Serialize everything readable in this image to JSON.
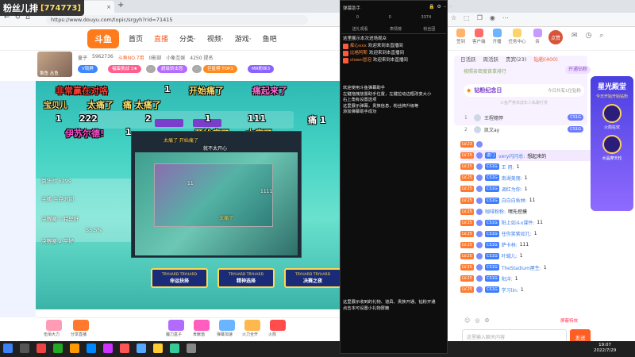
{
  "overlay_badge": {
    "title": "粉丝儿排",
    "count": "[774773]"
  },
  "browser": {
    "tab_title": "【粉丝儿排】小",
    "url": "https://www.douyu.com/topic/srgyh?rid=71415"
  },
  "site": {
    "logo": "斗鱼",
    "nav": [
      "首页",
      "直播",
      "分类·",
      "视频·",
      "游戏·",
      "鱼吧"
    ],
    "header_icons": [
      "签到",
      "客户端",
      "开播",
      "任务中心",
      "亲"
    ],
    "avatar_text": "点赞"
  },
  "room": {
    "meta": [
      "童子",
      "5962736",
      "斗鱼NO.7用",
      "0影部",
      "小象互娱",
      "4250 提名"
    ],
    "name_tag": "鲁鱼 丛鱼",
    "v_label": "V锁屏",
    "pills": [
      "福蛋挑战 3★",
      "·",
      "超级斩击怒",
      "·",
      "巨星榜 TOP3",
      "MR粉丝3"
    ]
  },
  "video": {
    "danmaku": [
      {
        "text": "非常赢在对咯",
        "color": "#ff3b30"
      },
      {
        "text": "1",
        "color": "#ffffff"
      },
      {
        "text": "开始痛了",
        "color": "#ffe066"
      },
      {
        "text": "痛起来了",
        "color": "#ff6ad5"
      },
      {
        "text": "宝贝儿",
        "color": "#ffe066"
      },
      {
        "text": "太痛了",
        "color": "#ffe066"
      },
      {
        "text": "痛 太痛了",
        "color": "#ffe066"
      },
      {
        "text": "1",
        "color": "#ffffff"
      },
      {
        "text": "222",
        "color": "#ffffff"
      },
      {
        "text": "2",
        "color": "#ffffff"
      },
      {
        "text": "1",
        "color": "#ffffff"
      },
      {
        "text": "111",
        "color": "#ffffff"
      },
      {
        "text": "痛 1",
        "color": "#ffffff"
      },
      {
        "text": "伊苏尔德!",
        "color": "#ff4dd2"
      },
      {
        "text": "1",
        "color": "#ffffff"
      },
      {
        "text": "开始痛了",
        "color": "#ffe066"
      },
      {
        "text": "太痛了",
        "color": "#ffe066"
      }
    ],
    "left_texts": [
      "倒计时 529s",
      "主播 生存时间",
      "决赛圈 1 特异好",
      "55.5%",
      "决赛圈 2 平好"
    ],
    "inner_danmaku": [
      "太痛了 开始痛了",
      "就不太开心",
      "11",
      "1111",
      "太痛了"
    ],
    "game_buttons": [
      {
        "top": "TRYHARD TRYHARD",
        "label": "命运抉择"
      },
      {
        "top": "TRYHARD TRYHARD",
        "label": "精神选择"
      },
      {
        "top": "TRYHARD TRYHARD",
        "label": "决赛之夜"
      }
    ]
  },
  "gifts": [
    "伍佰大力",
    "分享直播",
    "魔力盒子",
    "贡献值",
    "弹幕加速",
    "火力全开",
    "火箭"
  ],
  "helper": {
    "title": "弹幕助手",
    "stats": [
      "0",
      "0",
      "3374"
    ],
    "tabs": [
      "送礼观看",
      "表情榜",
      "粉丝团"
    ],
    "lines": [
      {
        "name": "",
        "text": "这里展示本次进场观众"
      },
      {
        "name": "痴心xxx",
        "text": "欢迎来到本直播间"
      },
      {
        "name": "比格阿斯",
        "text": "欢迎来到本直播间"
      },
      {
        "name": "clown冒泡",
        "text": "欢迎来到本直播间"
      }
    ],
    "help_text": [
      "欢迎使用斗鱼弹幕助手",
      "左键拖拽放置助手位置，左键拉动边框改变大小",
      "右上角有设置选项",
      "这里展示弹幕，贵族信息，粉丝牌升级等",
      "添加弹幕助手成功"
    ],
    "bottom_text": [
      "这里展示收到的礼物、道具、贵族开通、钻粉开通",
      "点击本可设置小礼物屏蔽"
    ]
  },
  "rank": {
    "tabs": [
      "日活跃",
      "周活跃",
      "贵宾(23)",
      "钻粉(400)"
    ],
    "hint": "按照亲密度背拿排行",
    "join": "开通钻粉",
    "badge_label": "钻粉纪念日",
    "badge_right": "今日共有1位钻粉",
    "sub_hint": "斗鱼严禁未成年人私聊打赏",
    "rows": [
      {
        "no": "1",
        "name": "王程穗悍",
        "lv": "CS1G"
      },
      {
        "no": "2",
        "name": "凯文ay",
        "lv": "CS1G"
      }
    ]
  },
  "promo": {
    "title": "星光殿堂",
    "sub": "今日开始开始钻粉",
    "labels": [
      "火箭狂欢",
      "水晶摩天轮"
    ]
  },
  "chat": [
    {
      "lv": "LV.23",
      "cs": "",
      "name": "",
      "text": "",
      "hl": false
    },
    {
      "lv": "LV.25",
      "cs": "进门",
      "name": "very闪闪总:",
      "text": "想起来的",
      "hl": true
    },
    {
      "lv": "LV.25",
      "cs": "CS1G",
      "name": "王 用:",
      "text": "1",
      "hl": false
    },
    {
      "lv": "LV.25",
      "cs": "CS1G",
      "name": "南湖美丽:",
      "text": "1",
      "hl": false
    },
    {
      "lv": "LV.25",
      "cs": "CS1G",
      "name": "调红为你:",
      "text": "1",
      "hl": false
    },
    {
      "lv": "LV.25",
      "cs": "CS1G",
      "name": "白白白秋林:",
      "text": "11",
      "hl": false
    },
    {
      "lv": "LV.25",
      "cs": "",
      "name": "咖啡粉粉:",
      "text": "嘿先挖摸",
      "hl": false
    },
    {
      "lv": "LV.25",
      "cs": "CS1G",
      "name": "阳上如斗x课件:",
      "text": "11",
      "hl": false
    },
    {
      "lv": "LV.25",
      "cs": "CS1G",
      "name": "任你笑紫如兀:",
      "text": "1",
      "hl": false
    },
    {
      "lv": "LV.25",
      "cs": "CS1G",
      "name": "萨卡林:",
      "text": "111",
      "hl": false
    },
    {
      "lv": "LV.25",
      "cs": "CS1G",
      "name": "叶蛾儿:",
      "text": "1",
      "hl": false
    },
    {
      "lv": "LV.25",
      "cs": "CS1G",
      "name": "TheStadium屋生:",
      "text": "1",
      "hl": false
    },
    {
      "lv": "LV.25",
      "cs": "CS1G",
      "name": "阳洋:",
      "text": "1",
      "hl": false
    },
    {
      "lv": "LV.25",
      "cs": "CS1G",
      "name": "学习lin:",
      "text": "1",
      "hl": false
    }
  ],
  "chat_input": {
    "placeholder": "这里输入聊天内容",
    "send": "发送",
    "tools_right": "屏蔽特效"
  },
  "clock": {
    "time": "19:07",
    "date": "2022/7/29"
  }
}
